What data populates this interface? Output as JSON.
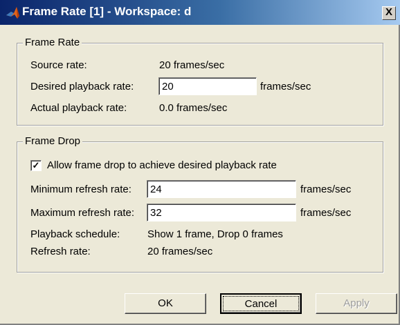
{
  "window": {
    "title": "Frame Rate [1] - Workspace: d",
    "close_label": "X"
  },
  "frame_rate": {
    "group_label": "Frame Rate",
    "source_rate_label": "Source rate:",
    "source_rate_value": "20 frames/sec",
    "desired_label": "Desired playback rate:",
    "desired_value": "20",
    "desired_unit": "frames/sec",
    "actual_label": "Actual playback rate:",
    "actual_value": "0.0 frames/sec"
  },
  "frame_drop": {
    "group_label": "Frame Drop",
    "allow_label": "Allow frame drop to achieve desired playback rate",
    "allow_checked_mark": "✓",
    "min_label": "Minimum refresh rate:",
    "min_value": "24",
    "min_unit": "frames/sec",
    "max_label": "Maximum refresh rate:",
    "max_value": "32",
    "max_unit": "frames/sec",
    "schedule_label": "Playback schedule:",
    "schedule_value": "Show 1 frame, Drop 0 frames",
    "refresh_label": "Refresh rate:",
    "refresh_value": "20 frames/sec"
  },
  "buttons": {
    "ok": "OK",
    "cancel": "Cancel",
    "apply": "Apply"
  },
  "icons": {
    "title_icon": "matlab-logo-icon"
  }
}
